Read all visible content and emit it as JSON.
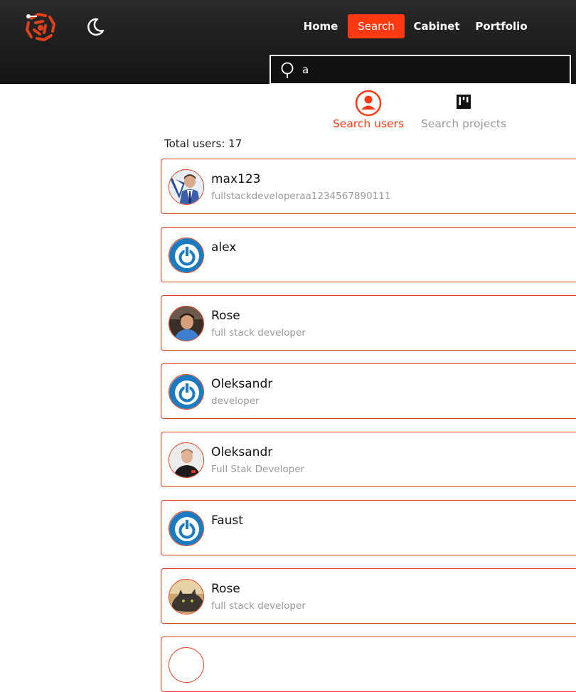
{
  "header": {
    "logo_icon": "circuit-gear-logo-icon",
    "theme_icon": "moon-icon",
    "nav": [
      {
        "label": "Home",
        "active": false
      },
      {
        "label": "Search",
        "active": true
      },
      {
        "label": "Cabinet",
        "active": false
      },
      {
        "label": "Portfolio",
        "active": false
      }
    ],
    "search": {
      "value": "a",
      "icon": "search-icon"
    }
  },
  "tabs": [
    {
      "label": "Search users",
      "icon": "user-circle-icon",
      "active": true
    },
    {
      "label": "Search projects",
      "icon": "board-icon",
      "active": false
    }
  ],
  "total_users": "Total users: 17",
  "users": [
    {
      "name": "max123",
      "subtitle": "fullstackdeveloperaa1234567890111",
      "avatar": "photo-man-suit"
    },
    {
      "name": "alex",
      "subtitle": "",
      "avatar": "default-power-avatar"
    },
    {
      "name": "Rose",
      "subtitle": "full stack developer",
      "avatar": "photo-young-man"
    },
    {
      "name": "Oleksandr",
      "subtitle": "developer",
      "avatar": "default-power-avatar"
    },
    {
      "name": "Oleksandr",
      "subtitle": "Full Stak Developer",
      "avatar": "photo-man-bald"
    },
    {
      "name": "Faust",
      "subtitle": "",
      "avatar": "default-power-avatar"
    },
    {
      "name": "Rose",
      "subtitle": "full stack developer",
      "avatar": "photo-cat"
    }
  ],
  "colors": {
    "accent": "#ff3a12",
    "card_border": "#e0401c",
    "default_avatar_blue": "#1c7bc0",
    "header_bg": "#1d1d1d",
    "muted_text": "#9a9a9a"
  }
}
